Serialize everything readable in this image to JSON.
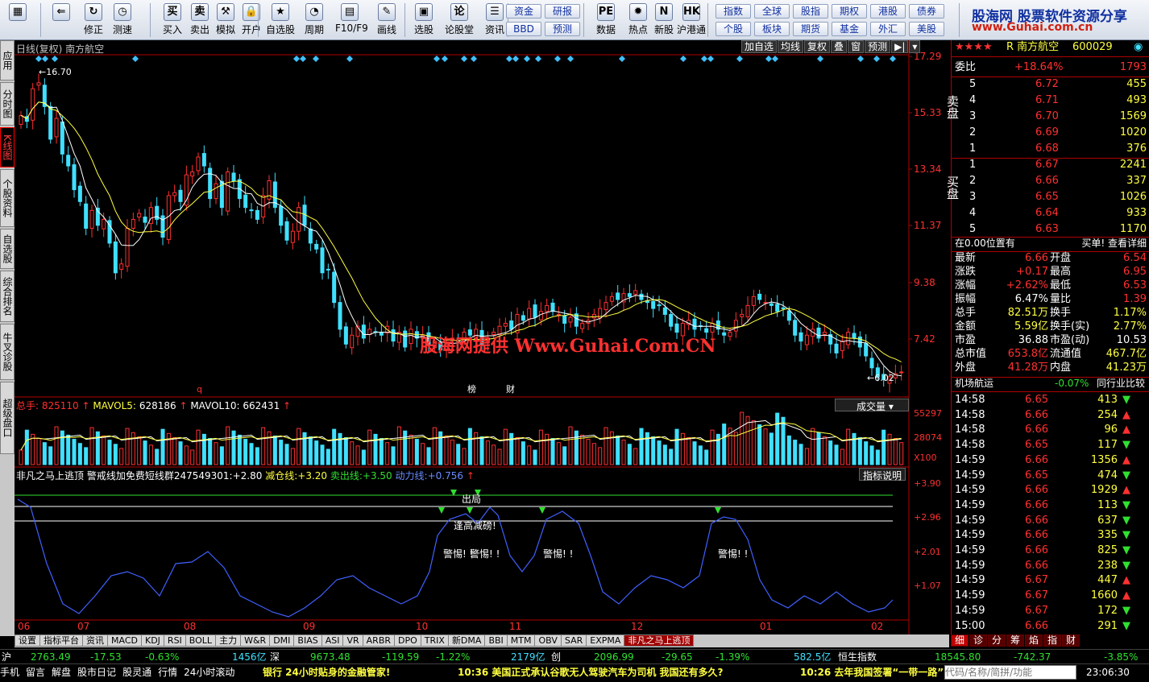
{
  "toolbar": {
    "items": [
      {
        "label": "",
        "icon": "windows-icon"
      },
      {
        "label": "",
        "icon": "back-arrow-icon"
      },
      {
        "label": "修正",
        "icon": "refresh-icon"
      },
      {
        "label": "测速",
        "icon": "clock-icon"
      },
      {
        "label": "买入",
        "icon": "buy-icon"
      },
      {
        "label": "卖出",
        "icon": "sell-icon"
      },
      {
        "label": "模拟",
        "icon": "hammer-icon"
      },
      {
        "label": "开户",
        "icon": "lock-icon"
      },
      {
        "label": "自选股",
        "icon": "star-icon"
      },
      {
        "label": "周期",
        "icon": "period-icon"
      },
      {
        "label": "F10/F9",
        "icon": "f10-icon"
      },
      {
        "label": "画线",
        "icon": "pen-icon"
      },
      {
        "label": "选股",
        "icon": "select-icon"
      },
      {
        "label": "论股堂",
        "icon": "forum-icon"
      },
      {
        "label": "资讯",
        "icon": "news-icon"
      },
      {
        "label": "数据",
        "icon": "data-icon"
      },
      {
        "label": "热点",
        "icon": "hot-icon"
      },
      {
        "label": "新股",
        "icon": "newstock-icon"
      },
      {
        "label": "沪港通",
        "icon": "hk-icon"
      }
    ],
    "small_buttons": [
      "资金",
      "研报",
      "BBD",
      "预测",
      "指数",
      "全球",
      "股指",
      "期权",
      "港股",
      "债券",
      "个股",
      "板块",
      "期货",
      "基金",
      "外汇",
      "美股"
    ],
    "brand": "股海网 股票软件资源分享",
    "brand_url": "www.Guhai.com.cn"
  },
  "left_tabs": [
    "应用",
    "分时图",
    "K线图",
    "个股资料",
    "自选股",
    "综合排名",
    "牛叉诊股",
    "超级盘口"
  ],
  "main_chart": {
    "header": "日线(复权) 南方航空",
    "controls": [
      "加自选",
      "均线",
      "复权",
      "叠",
      "窗",
      "预测"
    ],
    "y_ticks": [
      "17.29",
      "15.33",
      "13.34",
      "11.37",
      "9.38",
      "7.42"
    ],
    "high_label": "16.70",
    "low_label": "6.02",
    "watermark": "股海网提供 Www.Guhai.Com.CN",
    "markers": [
      "q",
      "榜",
      "财"
    ]
  },
  "volume": {
    "label": "总手",
    "value": "825110",
    "ma5_label": "MAVOL5:",
    "ma5": "628186",
    "ma10_label": "MAVOL10:",
    "ma10": "662431",
    "dropdown": "成交量",
    "y_ticks": [
      "55297",
      "28074",
      "X100"
    ]
  },
  "indicator": {
    "title": "非凡之马上逃顶",
    "line1": "警戒线加免费短线群247549301:",
    "v1": "+2.80",
    "line2": "减仓线:",
    "v2": "+3.20",
    "line3": "卖出线:",
    "v3": "+3.50",
    "line4": "动力线:",
    "v4": "+0.756",
    "help": "指标说明",
    "y_ticks": [
      "+3.90",
      "+2.96",
      "+2.01",
      "+1.07"
    ],
    "texts": [
      "出局",
      "逢高减磅!",
      "警惕!",
      "警惕!",
      "警惕!",
      "警惕!"
    ]
  },
  "x_axis": [
    "06",
    "07",
    "08",
    "09",
    "10",
    "11",
    "12",
    "01",
    "02"
  ],
  "bottom_tabs": [
    "设置",
    "指标平台",
    "资讯",
    "MACD",
    "KDJ",
    "RSI",
    "BOLL",
    "主力",
    "W&R",
    "DMI",
    "BIAS",
    "ASI",
    "VR",
    "ARBR",
    "DPO",
    "TRIX",
    "新DMA",
    "BBI",
    "MTM",
    "OBV",
    "SAR",
    "EXPMA",
    "非凡之马上逃顶"
  ],
  "quote": {
    "stars": "★★★★",
    "name": "R 南方航空",
    "code": "600029",
    "ratio_label": "委比",
    "ratio": "+18.64%",
    "ratio_vol": "1793",
    "sell": [
      [
        "5",
        "6.72",
        "455"
      ],
      [
        "4",
        "6.71",
        "493"
      ],
      [
        "3",
        "6.70",
        "1569"
      ],
      [
        "2",
        "6.69",
        "1020"
      ],
      [
        "1",
        "6.68",
        "376"
      ]
    ],
    "buy": [
      [
        "1",
        "6.67",
        "2241"
      ],
      [
        "2",
        "6.66",
        "337"
      ],
      [
        "3",
        "6.65",
        "1026"
      ],
      [
        "4",
        "6.64",
        "933"
      ],
      [
        "5",
        "6.63",
        "1170"
      ]
    ],
    "sell_label": "卖盘",
    "buy_label": "买盘",
    "pos_text": "在0.00位置有",
    "pos_link": "买单! 查看详细",
    "stats": [
      [
        "最新",
        "6.66",
        "开盘",
        "6.54"
      ],
      [
        "涨跌",
        "+0.17",
        "最高",
        "6.95"
      ],
      [
        "涨幅",
        "+2.62%",
        "最低",
        "6.53"
      ],
      [
        "振幅",
        "6.47%",
        "量比",
        "1.39"
      ],
      [
        "总手",
        "82.51万",
        "换手",
        "1.17%"
      ],
      [
        "金额",
        "5.59亿",
        "换手(实)",
        "2.77%"
      ],
      [
        "市盈",
        "36.88",
        "市盈(动)",
        "10.53"
      ],
      [
        "总市值",
        "653.8亿",
        "流通值",
        "467.7亿"
      ],
      [
        "外盘",
        "41.28万",
        "内盘",
        "41.23万"
      ]
    ],
    "industry": "机场航运",
    "industry_pct": "-0.07%",
    "industry_link": "同行业比较",
    "ticks": [
      [
        "14:58",
        "6.65",
        "413",
        "down"
      ],
      [
        "14:58",
        "6.66",
        "254",
        "up"
      ],
      [
        "14:58",
        "6.66",
        "96",
        "up"
      ],
      [
        "14:58",
        "6.65",
        "117",
        "down"
      ],
      [
        "14:59",
        "6.66",
        "1356",
        "up"
      ],
      [
        "14:59",
        "6.65",
        "474",
        "down"
      ],
      [
        "14:59",
        "6.66",
        "1929",
        "up"
      ],
      [
        "14:59",
        "6.66",
        "113",
        "down"
      ],
      [
        "14:59",
        "6.66",
        "637",
        "down"
      ],
      [
        "14:59",
        "6.66",
        "335",
        "down"
      ],
      [
        "14:59",
        "6.66",
        "825",
        "down"
      ],
      [
        "14:59",
        "6.66",
        "238",
        "down"
      ],
      [
        "14:59",
        "6.67",
        "447",
        "up"
      ],
      [
        "14:59",
        "6.67",
        "1660",
        "up"
      ],
      [
        "14:59",
        "6.67",
        "172",
        "down"
      ],
      [
        "15:00",
        "6.66",
        "291",
        "down"
      ]
    ],
    "right_tabs": [
      "细",
      "诊",
      "分",
      "筹",
      "焰",
      "指",
      "财"
    ]
  },
  "index_bar": {
    "sh": "沪",
    "sh_val": "2763.49",
    "sh_chg": "-17.53",
    "sh_pct": "-0.63%",
    "sh_amt": "1456亿",
    "sz": "深",
    "sz_val": "9673.48",
    "sz_chg": "-119.59",
    "sz_pct": "-1.22%",
    "sz_amt": "2179亿",
    "cy": "创",
    "cy_val": "2096.99",
    "cy_chg": "-29.65",
    "cy_pct": "-1.39%",
    "cy_amt": "582.5亿",
    "hs": "恒生指数",
    "hs_val": "18545.80",
    "hs_chg": "-742.37",
    "hs_pct": "-3.85%"
  },
  "status_bar": {
    "items": [
      "手机",
      "留言",
      "解盘",
      "股市日记",
      "股灵通",
      "行情",
      "24小时滚动"
    ],
    "ad": "银行 24小时贴身的金融管家!",
    "news1": "10:36 美国正式承认谷歌无人驾驶汽车为司机 我国还有多久?",
    "news2": "10:26 去年我国签署“一带一路”",
    "search_placeholder": "代码/名称/简拼/功能",
    "time": "23:06:30"
  },
  "colors": {
    "up": "#ff3030",
    "down": "#40e0ff",
    "bg": "#000000",
    "grid": "#b00000"
  }
}
